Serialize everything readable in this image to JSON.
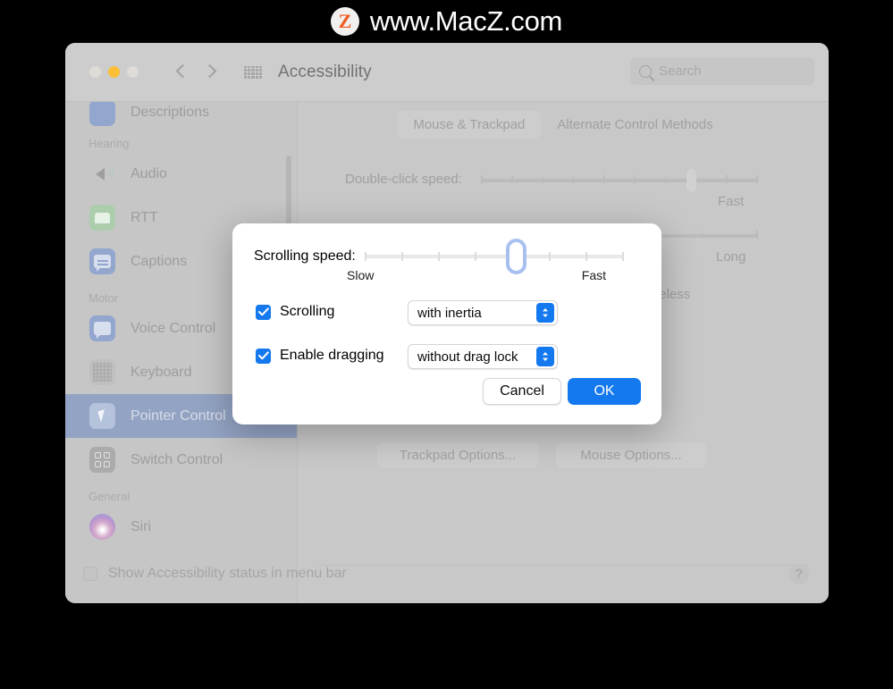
{
  "watermark": {
    "logo_letter": "Z",
    "text": "www.MacZ.com"
  },
  "window": {
    "title": "Accessibility",
    "search_placeholder": "Search",
    "traffic_lights": [
      "close-button",
      "minimize-button",
      "zoom-button"
    ],
    "nav_back": "back-button",
    "nav_forward": "forward-button",
    "grid_button": "show-all-button"
  },
  "sidebar": {
    "items": [
      {
        "label": "Descriptions",
        "icon": "descriptions-icon",
        "type": "item",
        "selected": false
      },
      {
        "label": "Hearing",
        "type": "header"
      },
      {
        "label": "Audio",
        "icon": "audio-icon",
        "type": "item",
        "selected": false
      },
      {
        "label": "RTT",
        "icon": "rtt-icon",
        "type": "item",
        "selected": false
      },
      {
        "label": "Captions",
        "icon": "captions-icon",
        "type": "item",
        "selected": false
      },
      {
        "label": "Motor",
        "type": "header"
      },
      {
        "label": "Voice Control",
        "icon": "voice-control-icon",
        "type": "item",
        "selected": false
      },
      {
        "label": "Keyboard",
        "icon": "keyboard-icon",
        "type": "item",
        "selected": false
      },
      {
        "label": "Pointer Control",
        "icon": "pointer-control-icon",
        "type": "item",
        "selected": true
      },
      {
        "label": "Switch Control",
        "icon": "switch-control-icon",
        "type": "item",
        "selected": false
      },
      {
        "label": "General",
        "type": "header"
      },
      {
        "label": "Siri",
        "icon": "siri-icon",
        "type": "item",
        "selected": false
      }
    ]
  },
  "content": {
    "tabs": [
      {
        "label": "Mouse & Trackpad",
        "selected": true
      },
      {
        "label": "Alternate Control Methods",
        "selected": false
      }
    ],
    "double_click_label": "Double-click speed:",
    "double_click_end": "Fast",
    "spring_end": "Long",
    "wireless_text": "wireless",
    "buttons": [
      {
        "label": "Trackpad Options..."
      },
      {
        "label": "Mouse Options..."
      }
    ],
    "footer_checkbox_label": "Show Accessibility status in menu bar",
    "help_label": "?"
  },
  "sheet": {
    "scrolling_speed_label": "Scrolling speed:",
    "slider_min_label": "Slow",
    "slider_max_label": "Fast",
    "slider_value_percent": 55,
    "checkboxes": [
      {
        "label": "Scrolling",
        "checked": true
      },
      {
        "label": "Enable dragging",
        "checked": true
      }
    ],
    "popups": [
      {
        "value": "with inertia"
      },
      {
        "value": "without drag lock"
      }
    ],
    "cancel_label": "Cancel",
    "ok_label": "OK"
  },
  "colors": {
    "accent_blue": "#1479ef",
    "selection_blue": "#8fa0c1",
    "window_gray": "#c6c6c6",
    "sheet_white": "#ffffff",
    "watermark_orange": "#ef5b25"
  }
}
